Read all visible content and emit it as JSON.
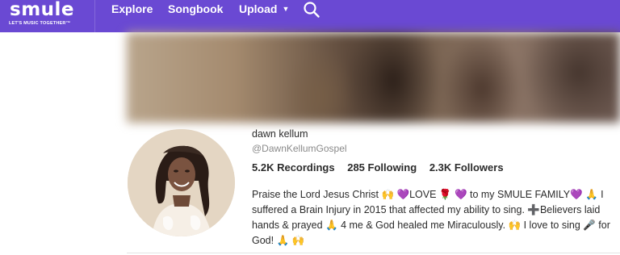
{
  "brand": {
    "name": "smule",
    "tagline": "LET'S MUSIC TOGETHER™",
    "color": "#6a49d3"
  },
  "nav": {
    "explore": "Explore",
    "songbook": "Songbook",
    "upload": "Upload",
    "upload_caret": "▼",
    "search_icon": "search-icon"
  },
  "profile": {
    "display_name": "dawn kellum",
    "handle": "@DawnKellumGospel",
    "stats": {
      "recordings": "5.2K Recordings",
      "following": "285 Following",
      "followers": "2.3K Followers"
    },
    "bio_lines": [
      "Praise the Lord Jesus Christ 🙌 💜LOVE 🌹 💜 to my SMULE FAMILY💜 🙏 I",
      "suffered a Brain Injury in 2015 that affected my ability to sing. ➕Believers laid",
      "hands & prayed 🙏 4 me & God healed me Miraculously. 🙌 I love to sing 🎤 for",
      "God! 🙏 🙌"
    ]
  }
}
